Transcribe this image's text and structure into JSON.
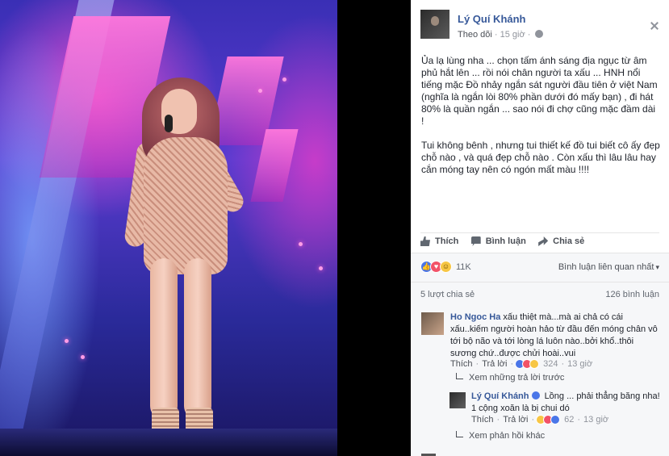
{
  "post": {
    "author": "Lý Quí Khánh",
    "follow_label": "Theo dõi",
    "time": "15 giờ",
    "paragraph1": "Ủa lạ lùng nha ... chọn tấm ánh sáng địa ngục từ âm phủ hắt lên ... rồi nói chân người ta xấu ... HNH nổi tiếng mặc Đồ nhảy ngắn sát người đầu tiên ở việt Nam (nghĩa là ngắn lòi 80% phần dưới đó mấy bạn) , đi hát 80% là quần ngắn ... sao nói đi chợ cũng mặc đầm dài !",
    "paragraph2": "Tui không bênh , nhưng tui thiết kế đồ tui biết cô ấy đẹp chỗ nào , và quá đẹp chỗ nào . Còn xấu thì lâu lâu hay cắn móng tay nên có ngón mất màu !!!!"
  },
  "actions": {
    "like": "Thích",
    "comment": "Bình luận",
    "share": "Chia sẻ"
  },
  "summary": {
    "reaction_count": "11K",
    "relevant_label": "Bình luận liên quan nhất",
    "shares": "5 lượt chia sẻ",
    "comment_count": "126 bình luận"
  },
  "comments": [
    {
      "author": "Ho Ngoc Ha",
      "text": "xấu thiệt mà...mà ai chả có cái xấu..kiếm người hoàn hảo từ đầu đến móng chân vô tới bộ não và tới lòng lá luôn nào..bởi khổ..thôi sương chứ..được chửi hoài..vui",
      "like": "Thích",
      "reply": "Trả lời",
      "reactions": "324",
      "time": "13 giờ"
    }
  ],
  "view_earlier_replies": "Xem những trả lời trước",
  "reply": {
    "author": "Lý Quí Khánh",
    "text": "Lồng ... phải thẳng băng nha! 1 cộng xoăn là bị chui dó",
    "like": "Thích",
    "reply": "Trả lời",
    "reactions": "62",
    "time": "13 giờ"
  },
  "view_more_replies": "Xem phản hồi khác",
  "colors": {
    "link_blue": "#365899",
    "panel_bg": "#ffffff",
    "comments_bg": "#f6f7f9",
    "like_blue": "#4a76e8",
    "love_red": "#f25268",
    "haha_yellow": "#f7c644"
  }
}
